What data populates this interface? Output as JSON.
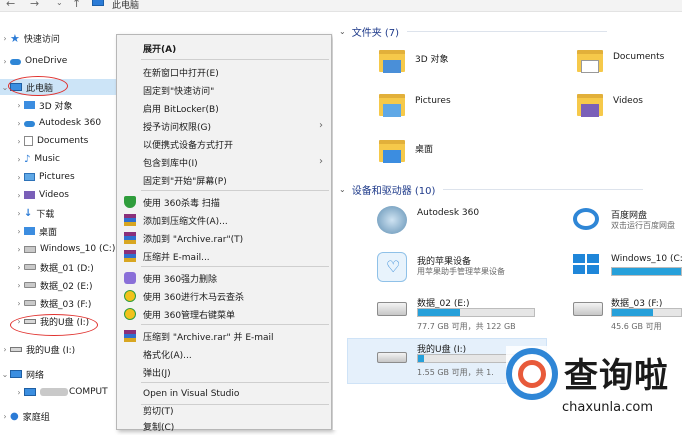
{
  "window": {
    "breadcrumb": "此电脑"
  },
  "nav": {
    "quick_access": "快速访问",
    "onedrive": "OneDrive",
    "this_pc": "此电脑",
    "items": [
      {
        "label": "3D 对象"
      },
      {
        "label": "Autodesk 360"
      },
      {
        "label": "Documents"
      },
      {
        "label": "Music"
      },
      {
        "label": "Pictures"
      },
      {
        "label": "Videos"
      },
      {
        "label": "下载"
      },
      {
        "label": "桌面"
      },
      {
        "label": "Windows_10 (C:)"
      },
      {
        "label": "数据_01 (D:)"
      },
      {
        "label": "数据_02 (E:)"
      },
      {
        "label": "数据_03 (F:)"
      },
      {
        "label": "我的U盘 (I:)"
      }
    ],
    "usb_root": "我的U盘 (I:)",
    "network": "网络",
    "network_pc": "COMPUT",
    "homegroup": "家庭组"
  },
  "context_menu": {
    "items": [
      {
        "label": "展开(A)",
        "bold": true
      },
      {
        "label": "在新窗口中打开(E)"
      },
      {
        "label": "固定到\"快速访问\""
      },
      {
        "label": "启用 BitLocker(B)"
      },
      {
        "label": "授予访问权限(G)",
        "submenu": true
      },
      {
        "label": "以便携式设备方式打开"
      },
      {
        "label": "包含到库中(I)",
        "submenu": true
      },
      {
        "label": "固定到\"开始\"屏幕(P)"
      },
      {
        "label": "使用 360杀毒 扫描",
        "icon": "shield-icon"
      },
      {
        "label": "添加到压缩文件(A)...",
        "icon": "winrar-icon"
      },
      {
        "label": "添加到 \"Archive.rar\"(T)",
        "icon": "winrar-icon"
      },
      {
        "label": "压缩并 E-mail...",
        "icon": "winrar-icon"
      },
      {
        "label": "使用 360强力删除",
        "icon": "purple-icon"
      },
      {
        "label": "使用 360进行木马云查杀",
        "icon": "yellow-icon"
      },
      {
        "label": "使用 360管理右键菜单",
        "icon": "yellow-icon"
      },
      {
        "label": "压缩到 \"Archive.rar\" 并 E-mail",
        "icon": "winrar-icon"
      },
      {
        "label": "格式化(A)..."
      },
      {
        "label": "弹出(J)"
      },
      {
        "label": "Open in Visual Studio"
      },
      {
        "label": "剪切(T)"
      },
      {
        "label": "复制(C)"
      }
    ]
  },
  "content": {
    "folders_header": "文件夹 (7)",
    "folders": [
      {
        "label": "3D 对象"
      },
      {
        "label": "Documents"
      },
      {
        "label": "Pictures"
      },
      {
        "label": "Videos"
      },
      {
        "label": "桌面"
      }
    ],
    "devices_header": "设备和驱动器 (10)",
    "devices": [
      {
        "label": "Autodesk 360"
      },
      {
        "label": "百度网盘",
        "sub": "双击运行百度网盘"
      },
      {
        "label": "我的苹果设备",
        "sub": "用苹果助手管理苹果设备"
      },
      {
        "label": "Windows_10 (C:)"
      },
      {
        "label": "数据_02 (E:)",
        "sub": "77.7 GB 可用，共 122 GB",
        "fill": 0.36
      },
      {
        "label": "数据_03 (F:)",
        "sub": "45.6 GB 可用",
        "fill": 0.6
      },
      {
        "label": "我的U盘 (I:)",
        "sub": "1.55 GB 可用，共 1.",
        "fill": 0.05
      }
    ]
  },
  "watermark": {
    "text": "查询啦",
    "url": "chaxunla.com"
  },
  "colors": {
    "selection": "#cce4f7",
    "accent": "#2b7bd6",
    "annotation": "#e0312e",
    "drive_bar": "#26a0da"
  }
}
